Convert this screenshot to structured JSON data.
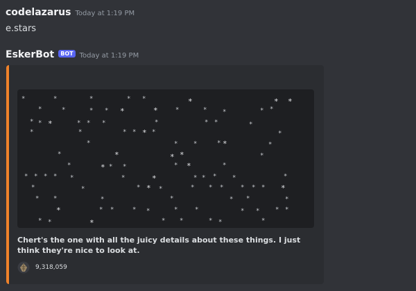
{
  "messages": [
    {
      "author": "codelazarus",
      "timestamp": "Today at 1:19 PM",
      "content": "e.stars"
    },
    {
      "author": "EskerBot",
      "badge": "BOT",
      "timestamp": "Today at 1:19 PM",
      "embed": {
        "accent_color": "#f0822a",
        "description": "Chert's the one with all the juicy details about these things. I just think they're nice to look at.",
        "footer": {
          "icon": "shell-icon",
          "text": "9,318,059"
        }
      }
    }
  ],
  "colors": {
    "background": "#313338",
    "embed_background": "#2b2d31",
    "image_background": "#1e1f22",
    "bot_badge": "#5865f2"
  }
}
